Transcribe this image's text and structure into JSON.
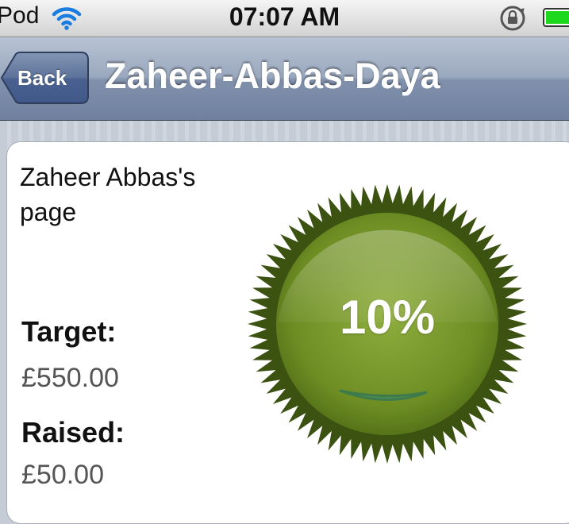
{
  "status_bar": {
    "carrier": "Pod",
    "time": "07:07 AM",
    "icons": [
      "wifi-icon",
      "rotation-lock-icon",
      "battery-icon"
    ]
  },
  "nav_bar": {
    "back_label": "Back",
    "title": "Zaheer-Abbas-Daya"
  },
  "page": {
    "description": "Zaheer Abbas's page",
    "target_label": "Target:",
    "target_value": "£550.00",
    "raised_label": "Raised:",
    "raised_value": "£50.00"
  },
  "progress": {
    "percent_label": "10%",
    "fraction": 0.1
  },
  "colors": {
    "badge_green": "#7a9a2e",
    "badge_dark": "#3c5210",
    "nav_blue": "#7f8fab",
    "battery_green": "#1ed81e"
  }
}
